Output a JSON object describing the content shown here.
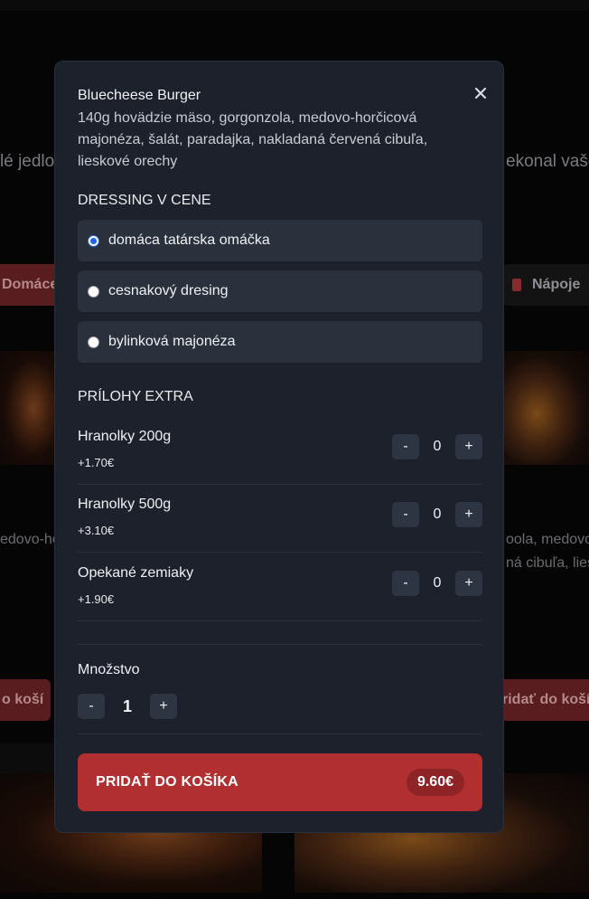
{
  "background": {
    "left_text": "lé jedlo",
    "right_text": "ekonal vaše",
    "tab_left": "Domáce",
    "tab_right": "Nápoje",
    "desc_left": "edovo-ho",
    "desc_right_1": "oola, medovo",
    "desc_right_2": "ná cibuľa, liesk",
    "btn_left": "o koší",
    "btn_right": "ridať do koší"
  },
  "modal": {
    "title": "Bluecheese Burger",
    "description": "140g hovädzie mäso, gorgonzola, medovo-horčicová majonéza, šalát, paradajka, nakladaná červená cibuľa, lieskové orechy",
    "dressing": {
      "heading": "DRESSING V CENE",
      "options": [
        {
          "label": "domáca tatárska omáčka",
          "checked": true
        },
        {
          "label": "cesnakový dresing",
          "checked": false
        },
        {
          "label": "bylinková majonéza",
          "checked": false
        }
      ]
    },
    "extras": {
      "heading": "PRÍLOHY EXTRA",
      "items": [
        {
          "name": "Hranolky 200g",
          "price": "+1.70€",
          "qty": "0"
        },
        {
          "name": "Hranolky 500g",
          "price": "+3.10€",
          "qty": "0"
        },
        {
          "name": "Opekané zemiaky",
          "price": "+1.90€",
          "qty": "0"
        }
      ],
      "minus": "-",
      "plus": "+"
    },
    "quantity": {
      "label": "Množstvo",
      "value": "1",
      "minus": "-",
      "plus": "+"
    },
    "add_button": {
      "label": "PRIDAŤ DO KOŠÍKA",
      "price": "9.60€"
    }
  },
  "colors": {
    "accent": "#b12f31",
    "modal_bg": "#1c212b",
    "radio_checked": "#2563eb"
  },
  "icons": {
    "close": "close-icon",
    "drink": "drink-icon"
  }
}
